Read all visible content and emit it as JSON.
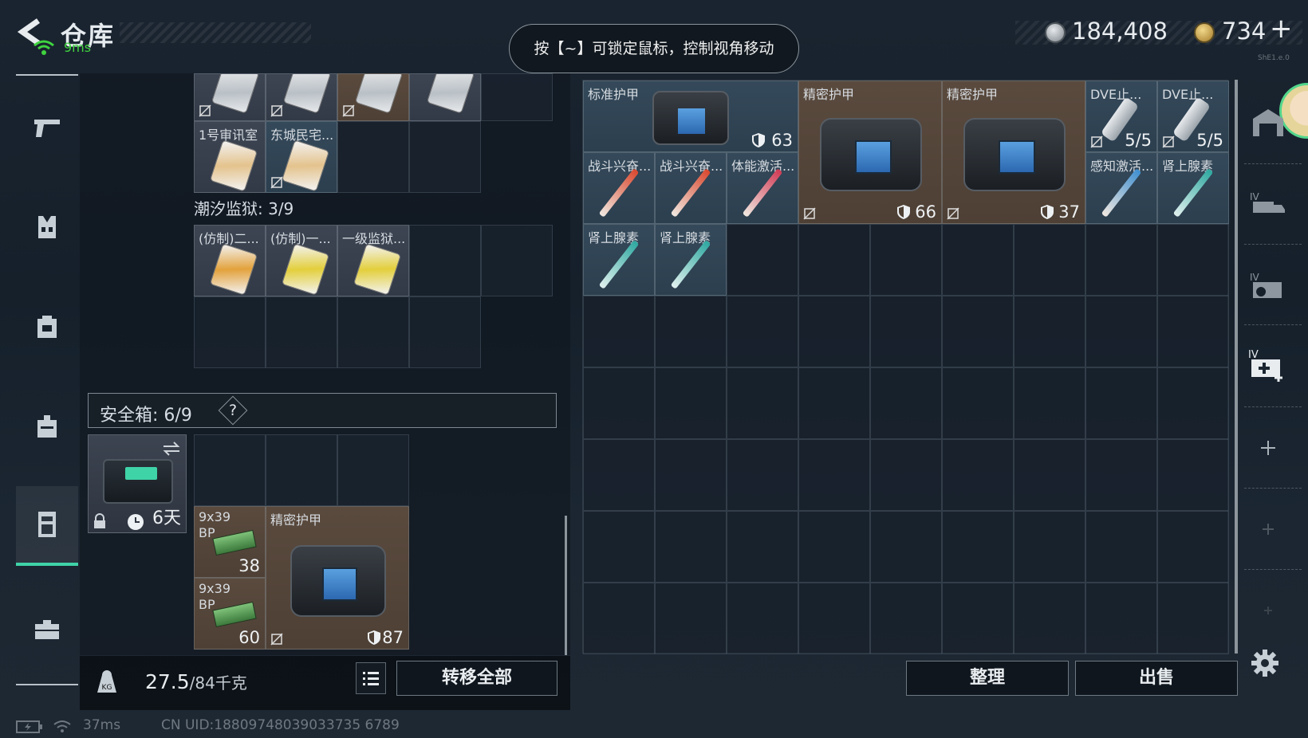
{
  "header": {
    "title": "仓库",
    "ping": "9ms",
    "tip": "按【~】可锁定鼠标，控制视角移动",
    "silver": "184,408",
    "gold": "734",
    "gold_plus": "+",
    "version": "ShE1.e.0"
  },
  "backpack": {
    "top_items": [
      {
        "name": "",
        "nolock": true
      },
      {
        "name": "",
        "nolock": true
      },
      {
        "name": "",
        "nolock": true
      },
      {
        "name": "",
        "nolock": false
      }
    ],
    "row2": [
      {
        "name": "1号审讯室",
        "nolock": false
      },
      {
        "name": "东城民宅...",
        "nolock": true
      }
    ],
    "prison_label": "潮汐监狱: 3/9",
    "prison_items": [
      {
        "name": "(仿制)二...",
        "color": "#e3a23c"
      },
      {
        "name": "(仿制)一...",
        "color": "#e3cf3c"
      },
      {
        "name": "一级监狱...",
        "color": "#e3cf3c"
      }
    ]
  },
  "safe_box": {
    "label": "安全箱: 6/9",
    "help": "?",
    "days": "6天",
    "ammo": [
      {
        "name": "9x39",
        "sub": "BP",
        "count": "38"
      },
      {
        "name": "9x39",
        "sub": "BP",
        "count": "60"
      }
    ],
    "armor": {
      "name": "精密护甲",
      "durability": "87"
    }
  },
  "footer": {
    "weight_value": "27.5",
    "weight_total": "/84千克",
    "transfer_all": "转移全部",
    "sort": "整理",
    "sell": "出售"
  },
  "warehouse": {
    "armor1": {
      "name": "标准护甲",
      "durability": "63"
    },
    "armor2": {
      "name": "精密护甲",
      "durability": "66"
    },
    "armor3": {
      "name": "精密护甲",
      "durability": "37"
    },
    "dve1": {
      "name": "DVE止...",
      "count": "5/5"
    },
    "dve2": {
      "name": "DVE止...",
      "count": "5/5"
    },
    "meds": [
      {
        "name": "战斗兴奋...",
        "color": "#d9482f"
      },
      {
        "name": "战斗兴奋...",
        "color": "#d9482f"
      },
      {
        "name": "体能激活...",
        "color": "#d13a55"
      },
      {
        "name": "感知激活...",
        "color": "#3f8fd0"
      },
      {
        "name": "肾上腺素",
        "color": "#2ea8a0"
      },
      {
        "name": "肾上腺素",
        "color": "#2ea8a0"
      },
      {
        "name": "肾上腺素",
        "color": "#2ea8a0"
      }
    ]
  },
  "status": {
    "ping": "37ms",
    "uid": "CN UID:18809748039033735 6789"
  }
}
